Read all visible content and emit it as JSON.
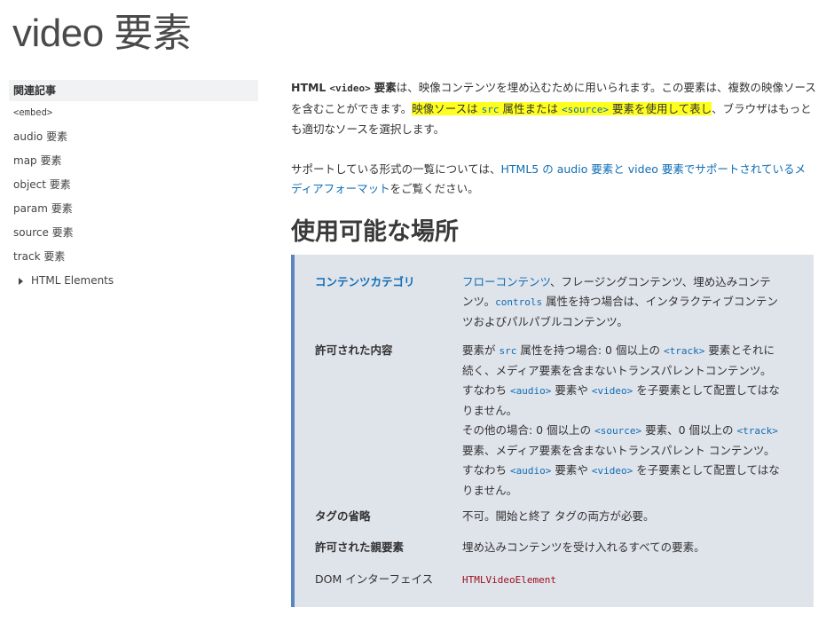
{
  "page": {
    "title": "video 要素"
  },
  "sidebar": {
    "heading": "関連記事",
    "items": [
      {
        "label": "<embed>"
      },
      {
        "label": "audio 要素"
      },
      {
        "label": "map 要素"
      },
      {
        "label": "object 要素"
      },
      {
        "label": "param 要素"
      },
      {
        "label": "source 要素"
      },
      {
        "label": "track 要素"
      }
    ],
    "tree_item": {
      "label": "HTML Elements"
    }
  },
  "intro": {
    "p1": {
      "t1": "HTML",
      "code1": "<video>",
      "t2": "要素",
      "t3": "は、映像コンテンツを埋め込むために用いられます。この要素は、複数の映像ソースを含むことができます。",
      "hl1": "映像ソースは",
      "code2": "src",
      "hl2": "属性または",
      "code3": "<source>",
      "hl3": "要素を使用して表し",
      "t4": "、ブラウザはもっとも適切なソースを選択します。"
    },
    "p2": {
      "t1": "サポートしている形式の一覧については、",
      "link": "HTML5 の audio 要素と video 要素でサポートされているメディアフォーマット",
      "t2": "をご覧ください。"
    }
  },
  "usage": {
    "heading": "使用可能な場所",
    "rows": {
      "content_category": {
        "term": "コンテンツカテゴリ",
        "def_link": "フローコンテンツ",
        "def_t1": "、フレージングコンテンツ、埋め込みコンテンツ。",
        "def_code": "controls",
        "def_t2": "属性を持つ場合は、インタラクティブコンテンツおよびパルパブルコンテンツ。"
      },
      "permitted_content": {
        "term": "許可された内容",
        "a_t1": "要素が",
        "a_code1": "src",
        "a_t2": "属性を持つ場合: 0 個以上の",
        "a_code2": "<track>",
        "a_t3": "要素とそれに続く、メディア要素を含まないトランスパレントコンテンツ。すなわち",
        "a_code3": "<audio>",
        "a_t4": "要素や",
        "a_code4": "<video>",
        "a_t5": "を子要素として配置してはなりません。",
        "b_t1": "その他の場合: 0 個以上の",
        "b_code1": "<source>",
        "b_t2": "要素、0 個以上の",
        "b_code2": "<track>",
        "b_t3": "要素、メディア要素を含まないトランスパレント コンテンツ。すなわち",
        "b_code3": "<audio>",
        "b_t4": "要素や",
        "b_code4": "<video>",
        "b_t5": "を子要素として配置してはなりません。"
      },
      "tag_omission": {
        "term": "タグの省略",
        "def": "不可。開始と終了 タグの両方が必要。"
      },
      "permitted_parents": {
        "term": "許可された親要素",
        "def": "埋め込みコンテンツを受け入れるすべての要素。"
      },
      "dom_interface": {
        "term": "DOM インターフェイス",
        "def": "HTMLVideoElement"
      }
    }
  },
  "colors": {
    "link": "#0f6db5",
    "highlight": "#ffff1f",
    "box_background": "#dfe3ea",
    "box_border": "#5a86bf",
    "dom_code": "#a01020"
  }
}
